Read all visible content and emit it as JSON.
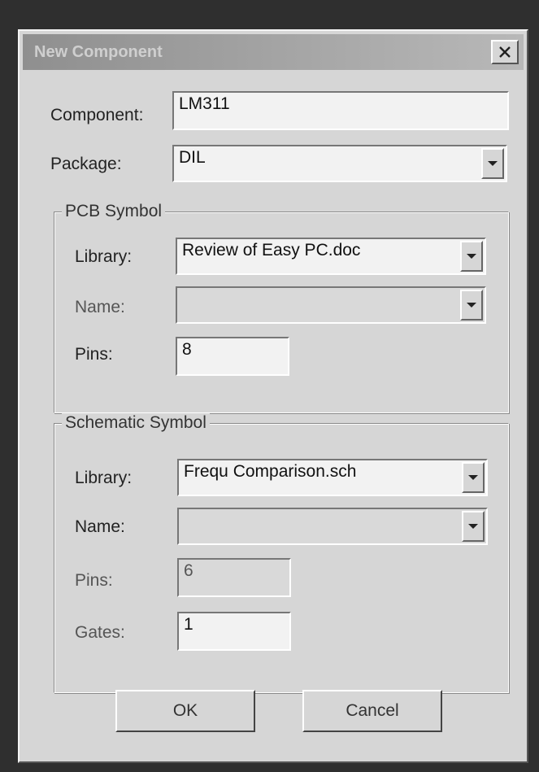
{
  "window": {
    "title": "New Component"
  },
  "component": {
    "label": "Component:",
    "value": "LM311"
  },
  "package": {
    "label": "Package:",
    "value": "DIL"
  },
  "pcb": {
    "legend": "PCB Symbol",
    "library_label": "Library:",
    "library_value": "Review of Easy PC.doc",
    "name_label": "Name:",
    "name_value": "",
    "pins_label": "Pins:",
    "pins_value": "8"
  },
  "schematic": {
    "legend": "Schematic Symbol",
    "library_label": "Library:",
    "library_value": "Frequ Comparison.sch",
    "name_label": "Name:",
    "name_value": "",
    "pins_label": "Pins:",
    "pins_value": "6",
    "gates_label": "Gates:",
    "gates_value": "1"
  },
  "buttons": {
    "ok": "OK",
    "cancel": "Cancel"
  },
  "icons": {
    "close": "close-icon",
    "dropdown": "chevron-down-icon"
  }
}
